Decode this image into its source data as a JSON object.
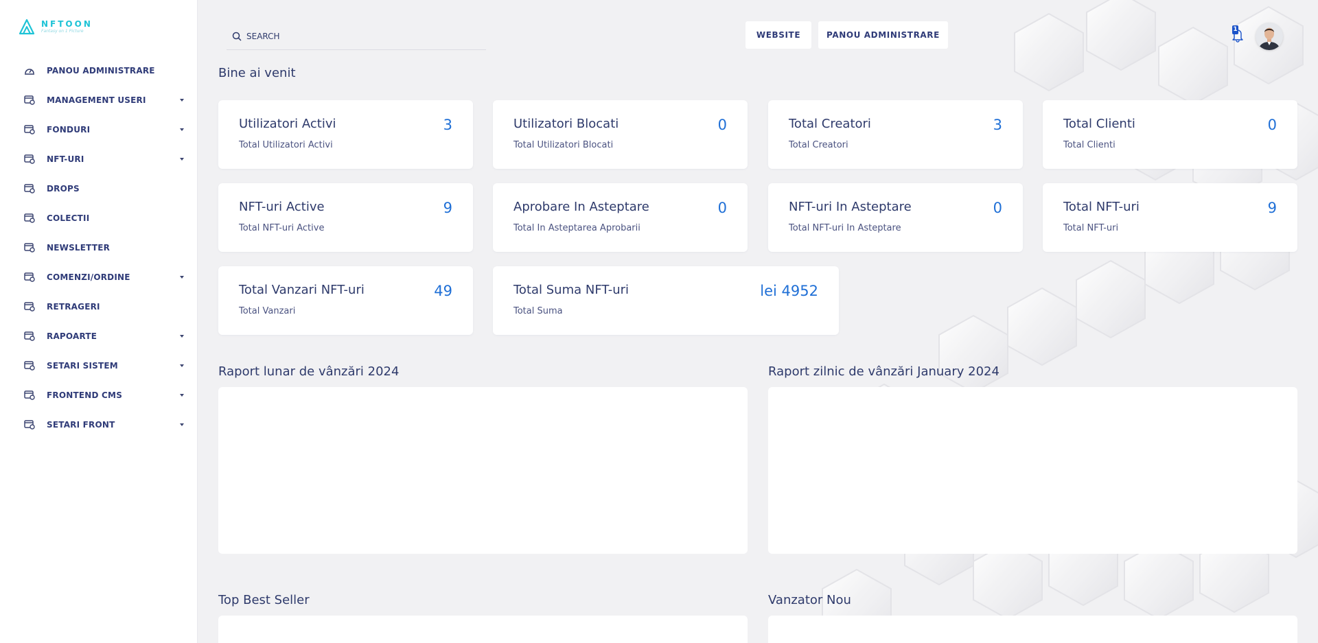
{
  "brand": {
    "name": "NFTOON",
    "tagline": "Fantasy on 1 Picture"
  },
  "nav": [
    {
      "label": "PANOU ADMINISTRARE",
      "icon": "dashboard-icon",
      "has_caret": false
    },
    {
      "label": "MANAGEMENT USERI",
      "icon": "module-icon",
      "has_caret": true
    },
    {
      "label": "FONDURI",
      "icon": "module-icon",
      "has_caret": true
    },
    {
      "label": "NFT-URI",
      "icon": "module-icon",
      "has_caret": true
    },
    {
      "label": "DROPS",
      "icon": "module-icon",
      "has_caret": false
    },
    {
      "label": "COLECTII",
      "icon": "module-icon",
      "has_caret": false
    },
    {
      "label": "NEWSLETTER",
      "icon": "module-icon",
      "has_caret": false
    },
    {
      "label": "COMENZI/ORDINE",
      "icon": "module-icon",
      "has_caret": true
    },
    {
      "label": "RETRAGERI",
      "icon": "module-icon",
      "has_caret": false
    },
    {
      "label": "RAPOARTE",
      "icon": "module-icon",
      "has_caret": true
    },
    {
      "label": "SETARI SISTEM",
      "icon": "module-icon",
      "has_caret": true
    },
    {
      "label": "FRONTEND CMS",
      "icon": "module-icon",
      "has_caret": true
    },
    {
      "label": "SETARI FRONT",
      "icon": "module-icon",
      "has_caret": true
    }
  ],
  "search": {
    "placeholder": "SEARCH"
  },
  "topbar": {
    "website_label": "WEBSITE",
    "admin_label": "PANOU ADMINISTRARE",
    "notification_count": "1"
  },
  "main": {
    "welcome": "Bine ai venit",
    "cards": [
      {
        "title": "Utilizatori Activi",
        "subtitle": "Total Utilizatori Activi",
        "value": "3"
      },
      {
        "title": "Utilizatori Blocati",
        "subtitle": "Total Utilizatori Blocati",
        "value": "0"
      },
      {
        "title": "Total Creatori",
        "subtitle": "Total Creatori",
        "value": "3"
      },
      {
        "title": "Total Clienti",
        "subtitle": "Total Clienti",
        "value": "0"
      },
      {
        "title": "NFT-uri Active",
        "subtitle": "Total NFT-uri Active",
        "value": "9"
      },
      {
        "title": "Aprobare In Asteptare",
        "subtitle": "Total In Asteptarea Aprobarii",
        "value": "0"
      },
      {
        "title": "NFT-uri In Asteptare",
        "subtitle": "Total NFT-uri In Asteptare",
        "value": "0"
      },
      {
        "title": "Total NFT-uri",
        "subtitle": "Total NFT-uri",
        "value": "9"
      },
      {
        "title": "Total Vanzari NFT-uri",
        "subtitle": "Total Vanzari",
        "value": "49"
      },
      {
        "title": "Total Suma NFT-uri",
        "subtitle": "Total Suma",
        "value": "lei 4952"
      }
    ],
    "sections": {
      "monthly_report": "Raport lunar de vânzări 2024",
      "daily_report": "Raport zilnic de vânzări January 2024",
      "top_seller": "Top Best Seller",
      "new_seller": "Vanzator Nou"
    }
  },
  "colors": {
    "accent": "#1f6fd6",
    "text": "#2e3a6b",
    "brand": "#1ec3d6",
    "badge": "#1a52c9"
  }
}
